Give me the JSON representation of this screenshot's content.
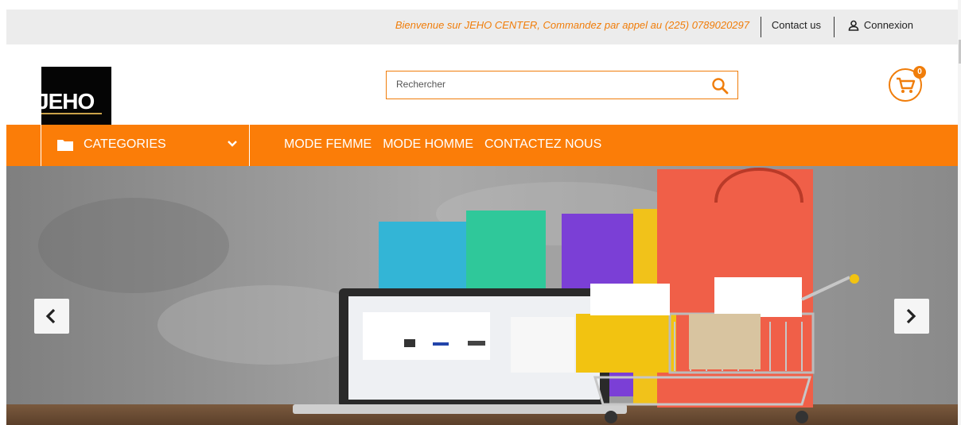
{
  "topbar": {
    "welcome": "Bienvenue sur JEHO CENTER, Commandez par appel au (225) 0789020297",
    "contact_label": "Contact us",
    "login_label": "Connexion",
    "login_icon": "user-icon"
  },
  "header": {
    "logo_text": "JEHO",
    "search": {
      "placeholder": "Rechercher",
      "value": ""
    },
    "search_icon": "search-icon",
    "cart": {
      "count": "0",
      "icon": "cart-icon"
    }
  },
  "nav": {
    "categories_label": "CATEGORIES",
    "categories_icon": "folder-icon",
    "links": [
      "MODE FEMME",
      "MODE HOMME",
      "CONTACTEZ NOUS"
    ]
  },
  "carousel": {
    "prev_icon": "chevron-left-icon",
    "next_icon": "chevron-right-icon"
  },
  "colors": {
    "accent": "#fb7d08",
    "topbar_bg": "#ececec"
  }
}
